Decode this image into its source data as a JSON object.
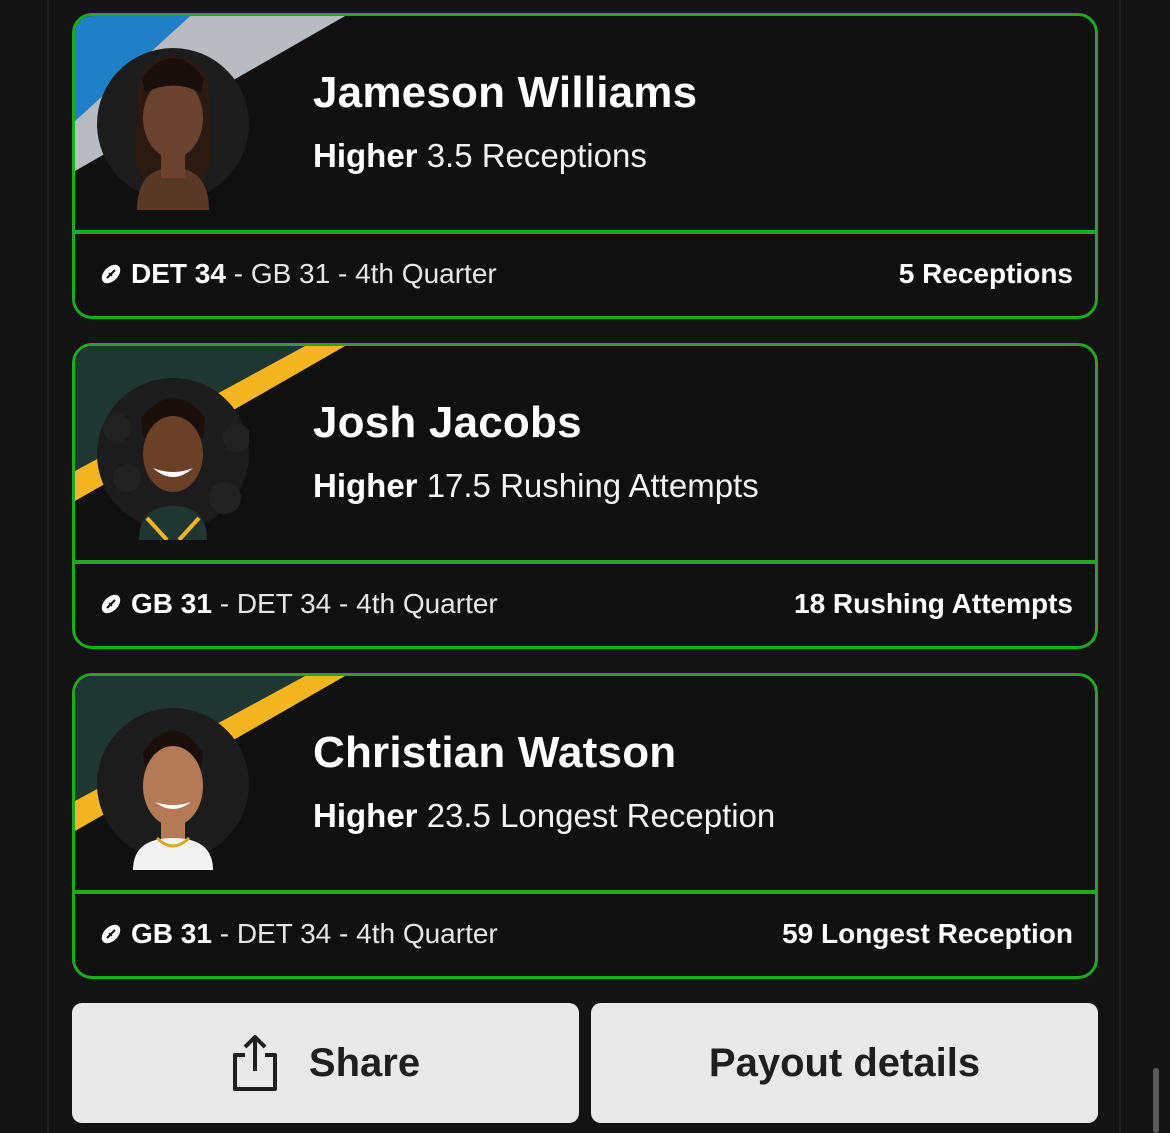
{
  "picks": [
    {
      "player": "Jameson Williams",
      "direction": "Higher",
      "line": "3.5 Receptions",
      "team_main": "DET 34",
      "game_rest": " - GB 31 - 4th Quarter",
      "result": "5 Receptions",
      "colors": {
        "stripe1": "#1f80c8",
        "stripe2": "#b8bcc0"
      }
    },
    {
      "player": "Josh Jacobs",
      "direction": "Higher",
      "line": "17.5 Rushing Attempts",
      "team_main": "GB 31",
      "game_rest": " - DET 34 - 4th Quarter",
      "result": "18 Rushing Attempts",
      "colors": {
        "stripe1": "#203731",
        "stripe2": "#f5b51f"
      }
    },
    {
      "player": "Christian Watson",
      "direction": "Higher",
      "line": "23.5 Longest Reception",
      "team_main": "GB 31",
      "game_rest": " - DET 34 - 4th Quarter",
      "result": "59 Longest Reception",
      "colors": {
        "stripe1": "#203731",
        "stripe2": "#f5b51f"
      }
    }
  ],
  "actions": {
    "share_label": "Share",
    "payout_label": "Payout details"
  },
  "icons": {
    "ball": "football-icon",
    "share": "share-icon"
  },
  "theme": {
    "accent_green": "#1fa91f",
    "background": "#131313",
    "button_bg": "#e9e9e9"
  }
}
